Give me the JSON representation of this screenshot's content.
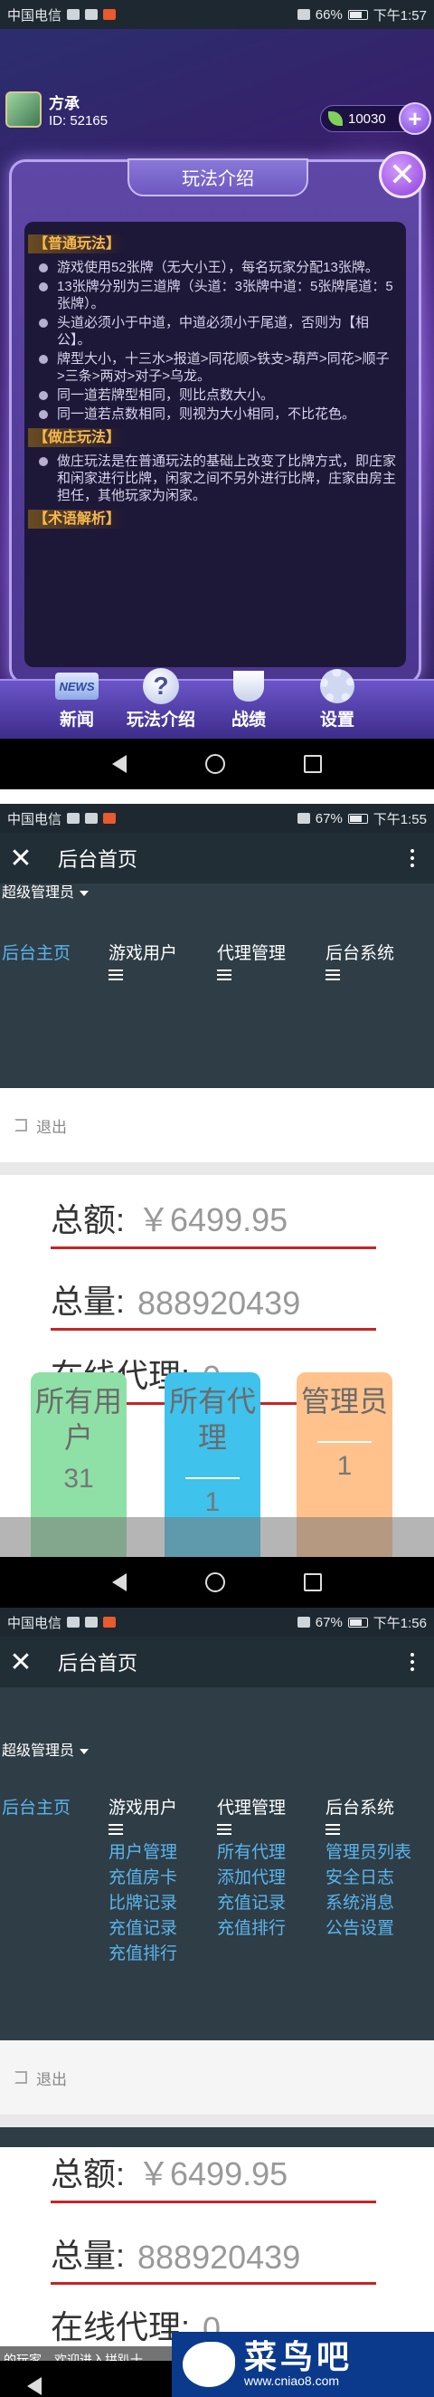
{
  "screen1": {
    "status": {
      "carrier": "中国电信",
      "battery": "66%",
      "time": "下午1:57"
    },
    "player": {
      "name": "方承",
      "id": "ID: 52165"
    },
    "coins": "10030",
    "panel_title": "玩法介绍",
    "sections": [
      {
        "head": "【普通玩法】",
        "rules": [
          "游戏使用52张牌（无大小王），每名玩家分配13张牌。",
          "13张牌分别为三道牌（头道：3张牌中道：5张牌尾道：5张牌）。",
          "头道必须小于中道，中道必须小于尾道，否则为【相公】。",
          "牌型大小，十三水>报道>同花顺>铁支>葫芦>同花>顺子>三条>两对>对子>乌龙。",
          "同一道若牌型相同，则比点数大小。",
          "同一道若点数相同，则视为大小相同，不比花色。"
        ]
      },
      {
        "head": "【做庄玩法】",
        "rules": [
          "做庄玩法是在普通玩法的基础上改变了比牌方式，即庄家和闲家进行比牌，闲家之间不另外进行比牌，庄家由房主担任，其他玩家为闲家。"
        ]
      },
      {
        "head": "【术语解析】",
        "rules": []
      }
    ],
    "bottom_nav": [
      {
        "label": "新闻",
        "icon": "news-icon",
        "icon_text": "NEWS"
      },
      {
        "label": "玩法介绍",
        "icon": "help-icon",
        "icon_text": "?"
      },
      {
        "label": "战绩",
        "icon": "trophy-icon",
        "icon_text": ""
      },
      {
        "label": "设置",
        "icon": "gear-icon",
        "icon_text": ""
      }
    ]
  },
  "screen2": {
    "status": {
      "carrier": "中国电信",
      "battery": "67%",
      "time": "下午1:55"
    },
    "title": "后台首页",
    "role": "超级管理员",
    "nav": [
      "后台主页",
      "游戏用户",
      "代理管理",
      "后台系统"
    ],
    "logout": "退出",
    "stats": {
      "total_label": "总额:",
      "total_value": "￥6499.95",
      "count_label": "总量:",
      "count_value": "888920439",
      "online_label": "在线代理:",
      "online_value": "0"
    },
    "tiles": [
      {
        "label": "所有用户",
        "value": "31"
      },
      {
        "label": "所有代理",
        "value": "1"
      },
      {
        "label": "管理员",
        "value": "1"
      }
    ]
  },
  "screen3": {
    "status": {
      "carrier": "中国电信",
      "battery": "67%",
      "time": "下午1:56"
    },
    "title": "后台首页",
    "role": "超级管理员",
    "nav": [
      "后台主页",
      "游戏用户",
      "代理管理",
      "后台系统"
    ],
    "submenu": {
      "game_users": [
        "用户管理",
        "充值房卡",
        "比牌记录",
        "充值记录",
        "充值排行"
      ],
      "agents": [
        "所有代理",
        "添加代理",
        "充值记录",
        "充值排行"
      ],
      "system": [
        "管理员列表",
        "安全日志",
        "系统消息",
        "公告设置"
      ]
    },
    "logout": "退出",
    "stats": {
      "total_label": "总额:",
      "total_value": "￥6499.95",
      "count_label": "总量:",
      "count_value": "888920439",
      "online_label": "在线代理:",
      "online_value": "0"
    },
    "marquee": "的玩家，欢迎进入拼趴十",
    "brand": {
      "name": "菜鸟吧",
      "url": "www.cniao8.com"
    }
  }
}
